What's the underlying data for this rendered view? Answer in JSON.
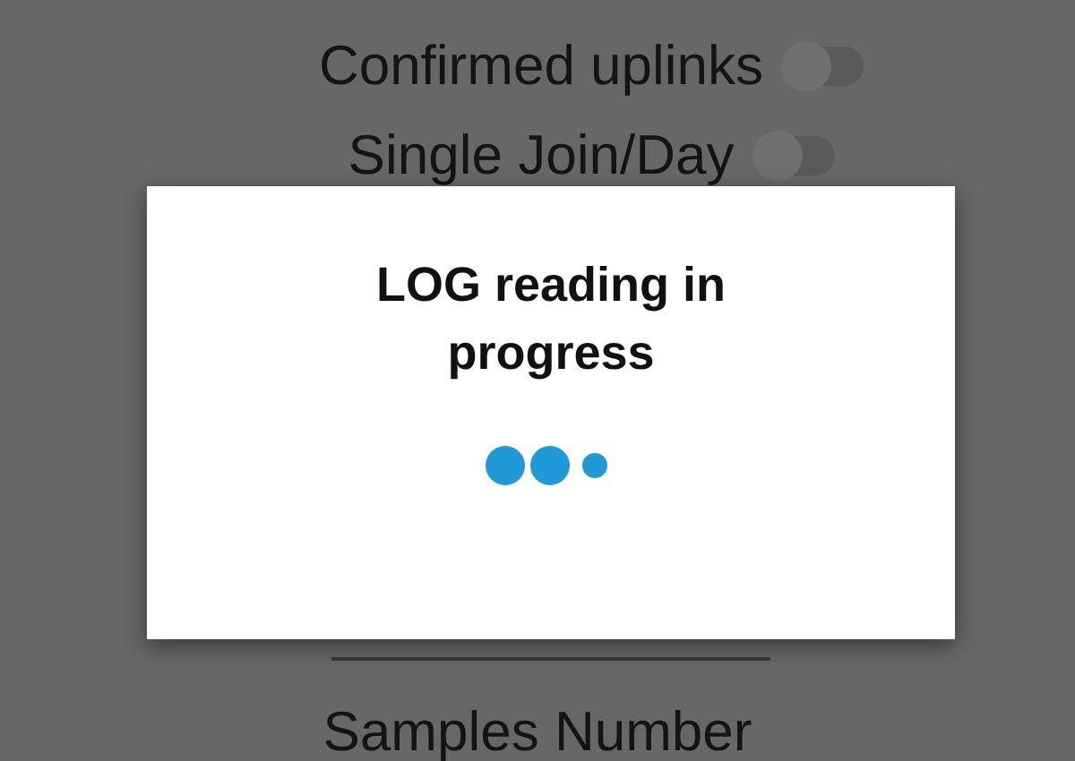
{
  "settings": [
    {
      "label": "Confirmed uplinks",
      "on": false
    },
    {
      "label": "Single Join/Day",
      "on": false
    }
  ],
  "samples_label": "Samples Number",
  "dialog": {
    "title": "LOG reading in progress"
  }
}
